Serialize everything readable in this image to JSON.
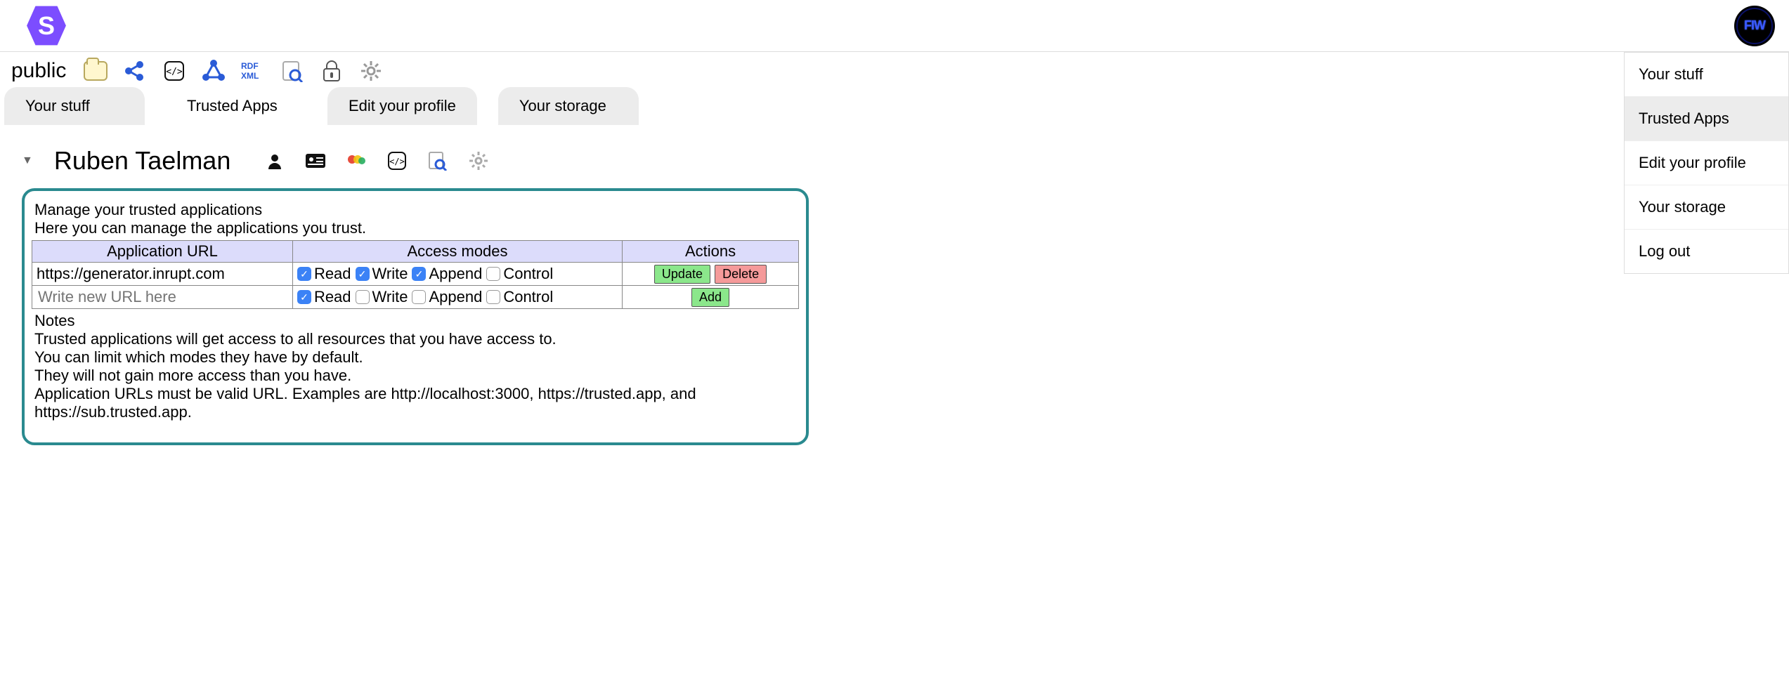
{
  "breadcrumb": "public",
  "tabs": [
    {
      "label": "Your stuff"
    },
    {
      "label": "Trusted Apps"
    },
    {
      "label": "Edit your profile"
    },
    {
      "label": "Your storage"
    }
  ],
  "profile": {
    "name": "Ruben Taelman"
  },
  "box": {
    "title": "Manage your trusted applications",
    "subtitle": "Here you can manage the applications you trust.",
    "columns": {
      "url": "Application URL",
      "modes": "Access modes",
      "actions": "Actions"
    },
    "modes": {
      "read": "Read",
      "write": "Write",
      "append": "Append",
      "control": "Control"
    },
    "rows": [
      {
        "url": "https://generator.inrupt.com",
        "read": true,
        "write": true,
        "append": true,
        "control": false,
        "actions": {
          "update": "Update",
          "delete": "Delete"
        }
      }
    ],
    "newrow": {
      "placeholder": "Write new URL here",
      "read": true,
      "write": false,
      "append": false,
      "control": false,
      "add": "Add"
    },
    "notes_heading": "Notes",
    "notes": [
      "Trusted applications will get access to all resources that you have access to.",
      "You can limit which modes they have by default.",
      "They will not gain more access than you have.",
      "Application URLs must be valid URL. Examples are http://localhost:3000, https://trusted.app, and https://sub.trusted.app."
    ]
  },
  "menu": [
    {
      "label": "Your stuff",
      "selected": false
    },
    {
      "label": "Trusted Apps",
      "selected": true
    },
    {
      "label": "Edit your profile",
      "selected": false
    },
    {
      "label": "Your storage",
      "selected": false
    },
    {
      "label": "Log out",
      "selected": false
    }
  ]
}
